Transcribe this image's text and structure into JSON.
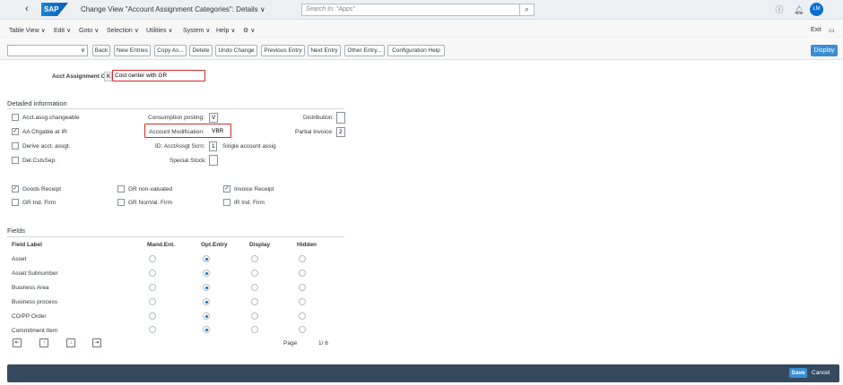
{
  "shell": {
    "logo": "SAP",
    "title": "Change View \"Account Assignment Categories\": Details",
    "title_chevron": "∨",
    "search_placeholder": "Search In: \"Apps\"",
    "avatar": "LM"
  },
  "menu": [
    "Table View",
    "Edit",
    "Goto",
    "Selection",
    "Utilities",
    "System",
    "Help"
  ],
  "menu_exit": "Exit",
  "toolbar": {
    "buttons": [
      "Back",
      "New Entries",
      "Copy As...",
      "Delete",
      "Undo Change",
      "Previous Entry",
      "Next Entry",
      "Other Entry...",
      "Configuration Help"
    ],
    "display": "Display"
  },
  "header": {
    "label": "Acct Assignment Cat.:",
    "code": "K",
    "value": "Cost center with GR"
  },
  "detailed": {
    "title": "Detailed information",
    "checkboxes_left": [
      {
        "label": "Acct.assg.changeable",
        "checked": false
      },
      {
        "label": "AA Chgable at IR",
        "checked": true
      },
      {
        "label": "Derive acct. assgt.",
        "checked": false
      },
      {
        "label": "Del.CstsSep.",
        "checked": false
      }
    ],
    "consumption_label": "Consumption posting:",
    "consumption_value": "V",
    "account_mod_label": "Account Modification:",
    "account_mod_value": "VBR",
    "id_label": "ID: AcctAssgt Scrn:",
    "id_value": "1",
    "id_desc": "Single account assig",
    "special_stock_label": "Special Stock:",
    "distribution_label": "Distribution:",
    "partial_invoice_label": "Partial Invoice:",
    "partial_invoice_value": "2",
    "checkboxes_bottom": [
      {
        "label": "Goods Receipt",
        "checked": true
      },
      {
        "label": "GR non-valuated",
        "checked": false
      },
      {
        "label": "Invoice Receipt",
        "checked": true
      },
      {
        "label": "GR Ind. Firm",
        "checked": false
      },
      {
        "label": "GR NonVal. Firm",
        "checked": false
      },
      {
        "label": "IR Ind. Firm",
        "checked": false
      }
    ]
  },
  "fields": {
    "title": "Fields",
    "columns": [
      "Field Label",
      "Mand.Ent.",
      "Opt.Entry",
      "Display",
      "Hidden"
    ],
    "rows": [
      {
        "label": "Asset",
        "selected": 1
      },
      {
        "label": "Asset Subnumber",
        "selected": 1
      },
      {
        "label": "Business Area",
        "selected": 1
      },
      {
        "label": "Business process",
        "selected": 1
      },
      {
        "label": "CO/PP Order",
        "selected": 1
      },
      {
        "label": "Commitment Item",
        "selected": 1
      }
    ],
    "page_label": "Page",
    "page_value": "1/ 6"
  },
  "footer": {
    "save": "Save",
    "cancel": "Cancel"
  }
}
